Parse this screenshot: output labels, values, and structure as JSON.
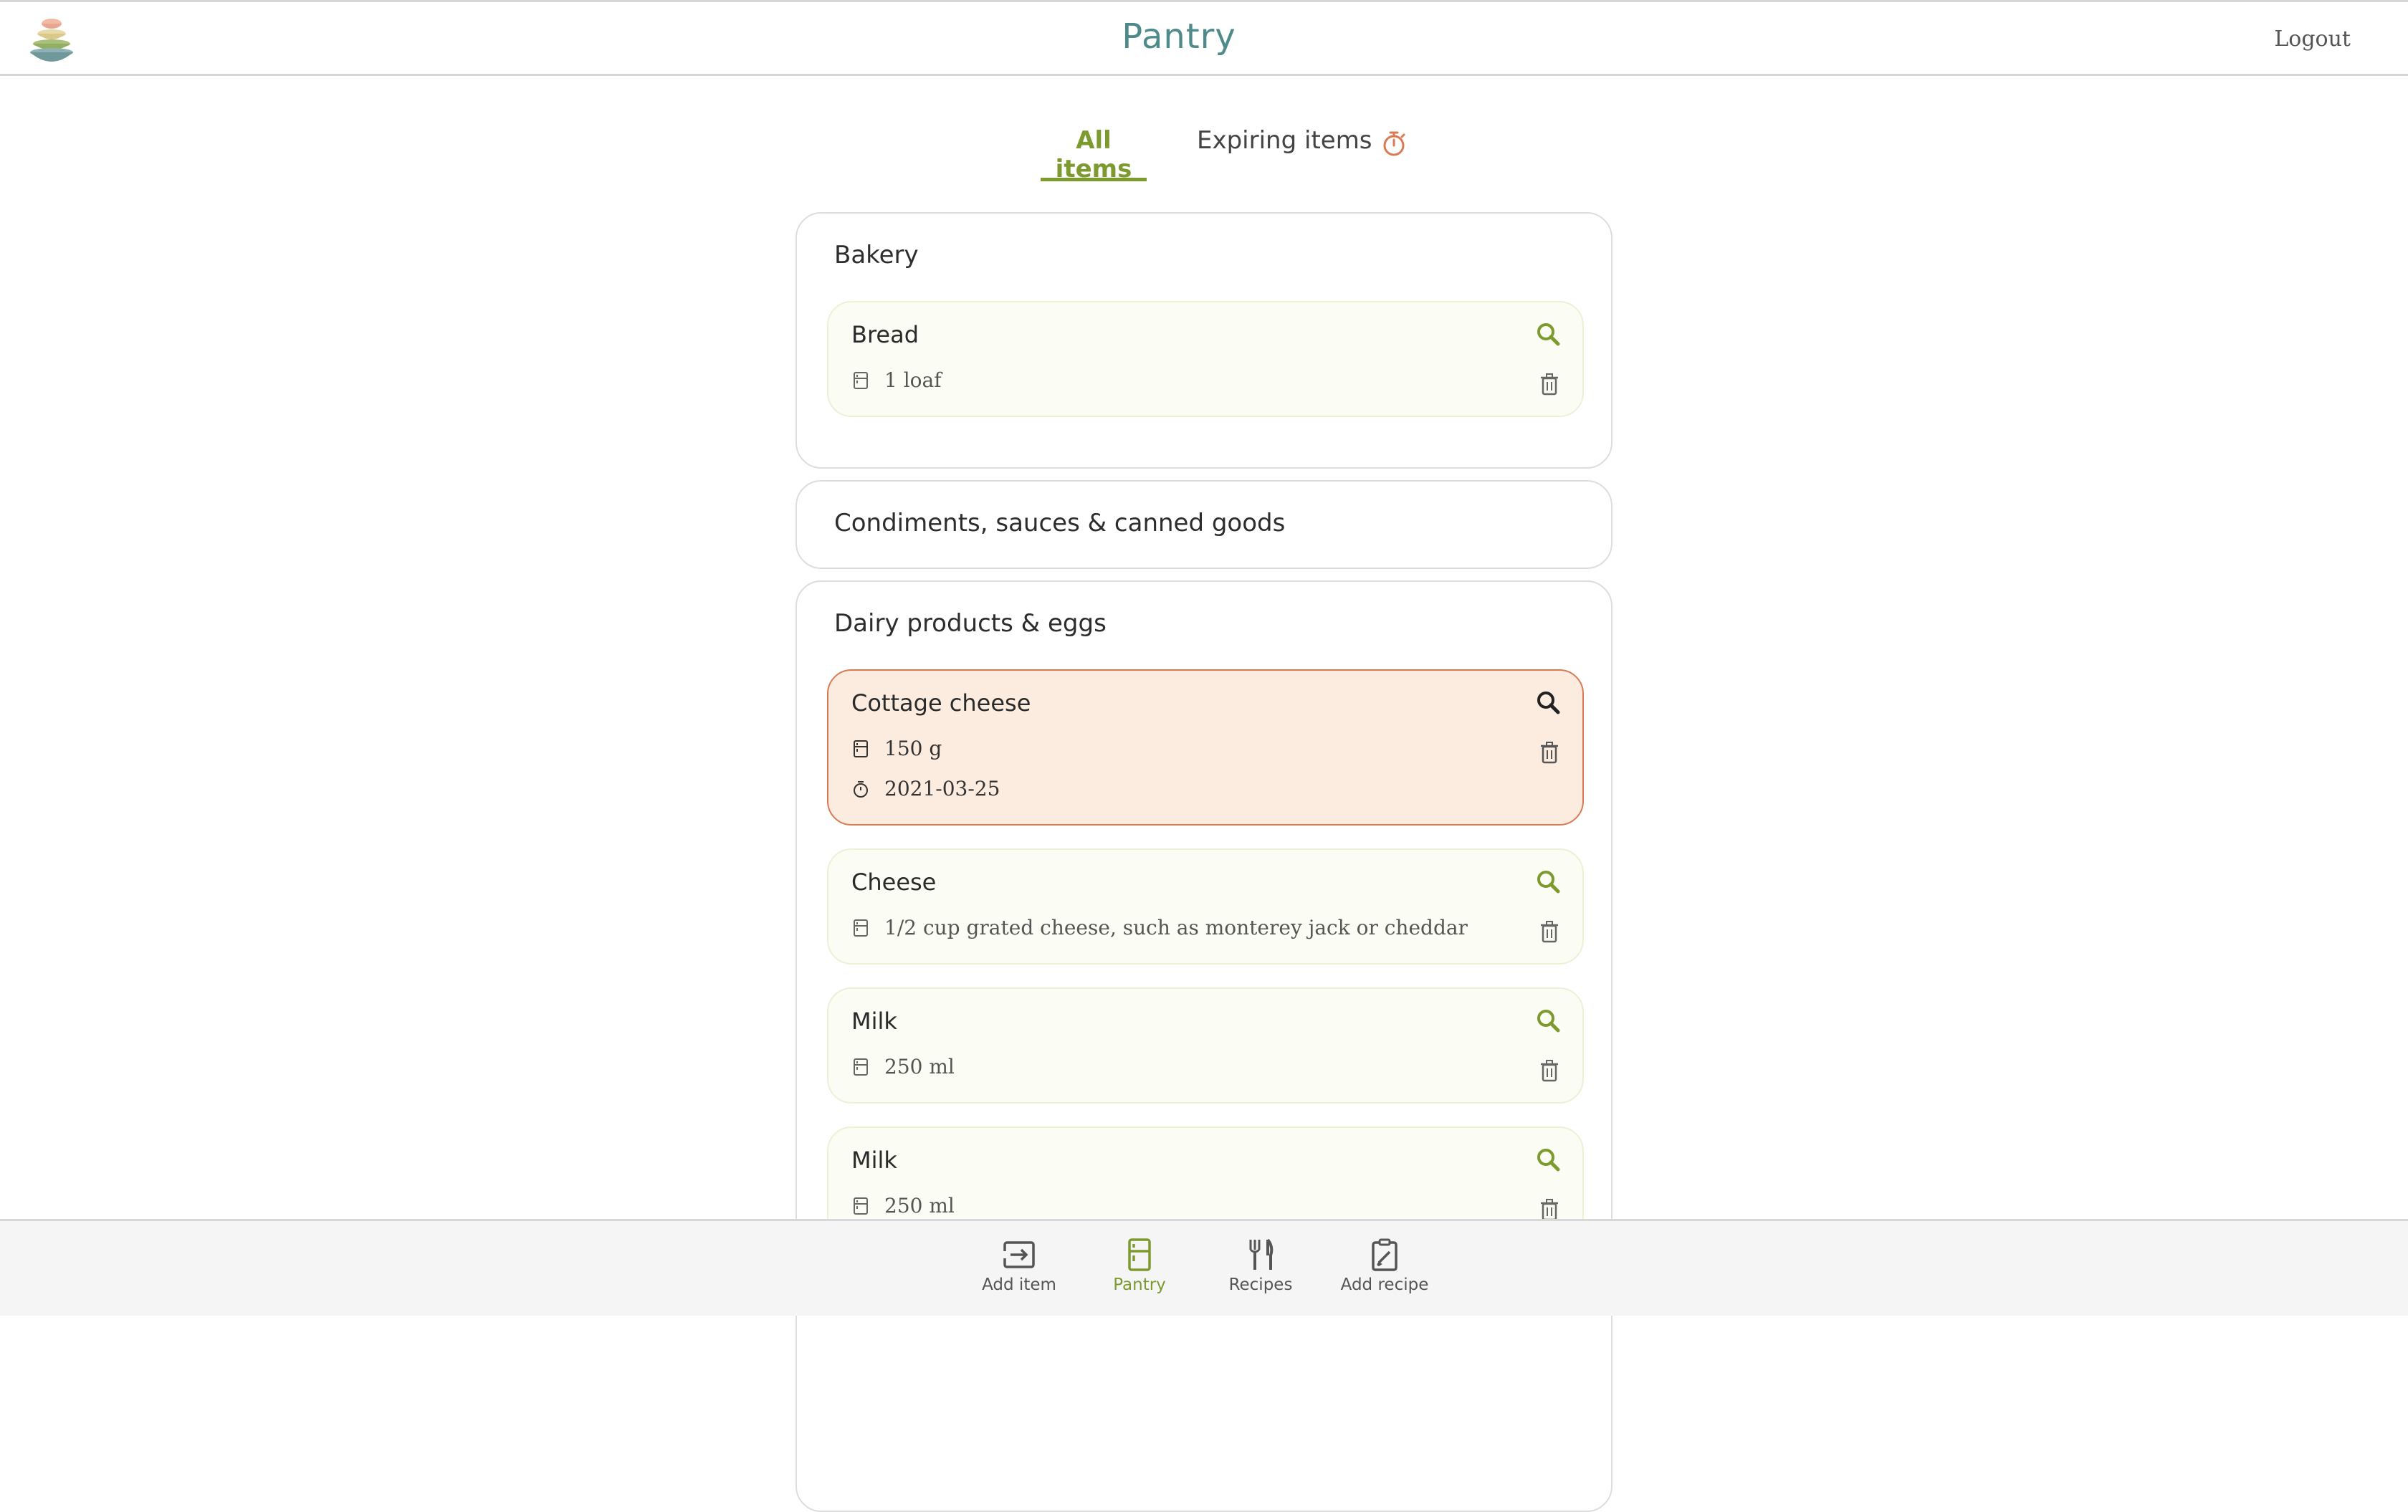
{
  "header": {
    "title": "Pantry",
    "logout_label": "Logout"
  },
  "tabs": [
    {
      "label": "All items",
      "active": true
    },
    {
      "label": "Expiring items",
      "icon": "stopwatch-icon",
      "active": false
    }
  ],
  "categories": [
    {
      "name": "Bakery",
      "items": [
        {
          "name": "Bread",
          "quantity": "1 loaf",
          "expiring": false
        }
      ]
    },
    {
      "name": "Condiments, sauces & canned goods",
      "items": []
    },
    {
      "name": "Dairy products & eggs",
      "items": [
        {
          "name": "Cottage cheese",
          "quantity": "150 g",
          "expiry_date": "2021-03-25",
          "expiring": true
        },
        {
          "name": "Cheese",
          "quantity": "1/2 cup grated cheese, such as monterey jack or cheddar",
          "expiring": false
        },
        {
          "name": "Milk",
          "quantity": "250 ml",
          "expiring": false
        },
        {
          "name": "Milk",
          "quantity": "250 ml",
          "expiring": false
        }
      ]
    }
  ],
  "bottom_nav": [
    {
      "label": "Add item",
      "icon": "add-item-icon"
    },
    {
      "label": "Pantry",
      "icon": "fridge-icon",
      "active": true
    },
    {
      "label": "Recipes",
      "icon": "utensils-icon"
    },
    {
      "label": "Add recipe",
      "icon": "edit-recipe-icon"
    }
  ],
  "colors": {
    "accent": "#7d9a2f",
    "title": "#4f8a8b",
    "expiring_bg": "#fcecdf",
    "expiring_border": "#d97a55",
    "timer_icon": "#d97a55"
  }
}
